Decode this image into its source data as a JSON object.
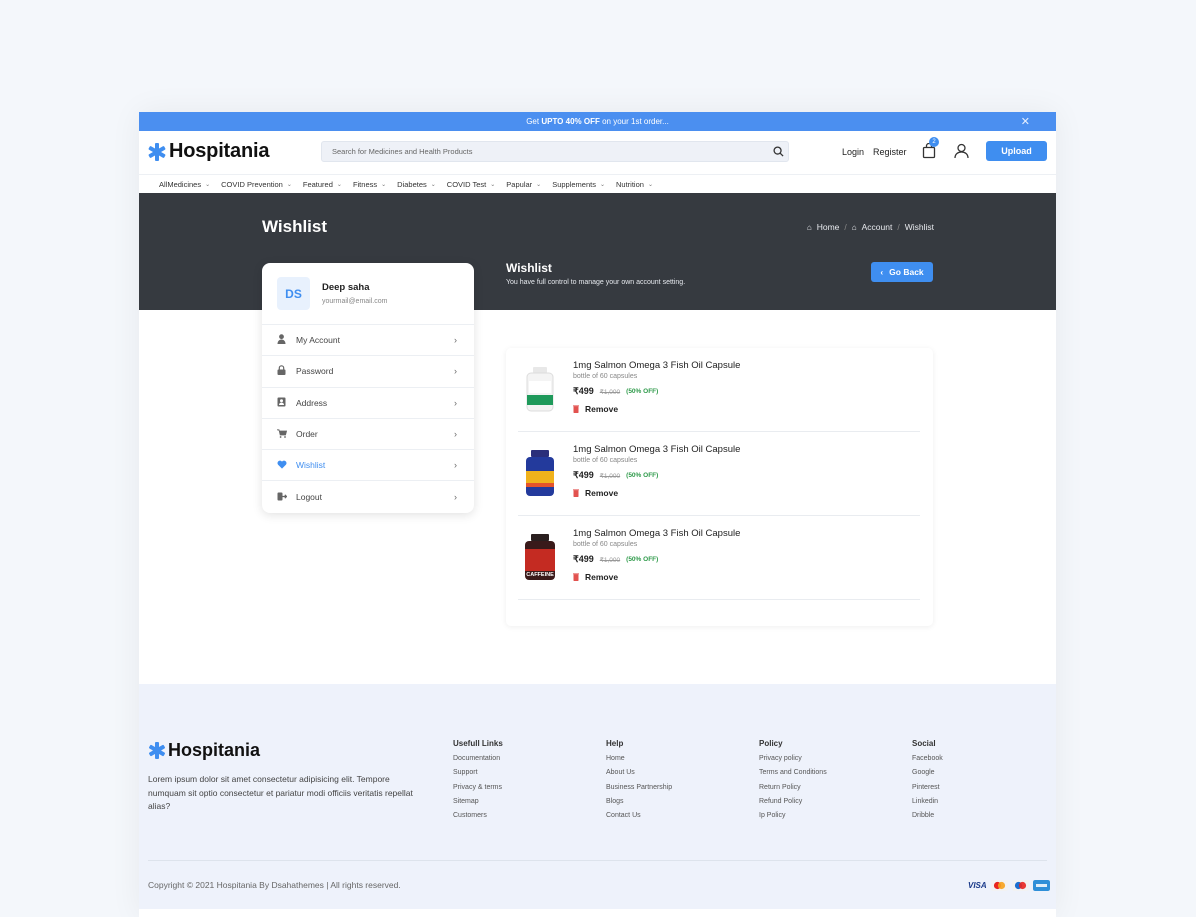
{
  "promo": {
    "prefix": "Get",
    "highlight": "UPTO 40% OFF",
    "suffix": "on your 1st order...",
    "close": "✕"
  },
  "brand": {
    "name": "Hospitania",
    "accent": "#3f8ef0"
  },
  "search": {
    "placeholder": "Search for Medicines and Health Products"
  },
  "header": {
    "login": "Login",
    "register": "Register",
    "cart_count": "2",
    "upload": "Upload"
  },
  "nav": [
    "AllMedicines",
    "COVID Prevention",
    "Featured",
    "Fitness",
    "Diabetes",
    "COVID Test",
    "Papular",
    "Supplements",
    "Nutrition"
  ],
  "hero": {
    "title": "Wishlist",
    "breadcrumb": [
      "Home",
      "Account",
      "Wishlist"
    ],
    "panel_title": "Wishlist",
    "panel_subtitle": "You have full control to manage your own account setting.",
    "go_back": "Go Back"
  },
  "profile": {
    "initials": "DS",
    "name": "Deep saha",
    "email": "yourmail@email.com"
  },
  "menu": [
    {
      "label": "My Account",
      "icon": "user-icon"
    },
    {
      "label": "Password",
      "icon": "lock-icon"
    },
    {
      "label": "Address",
      "icon": "address-book-icon"
    },
    {
      "label": "Order",
      "icon": "cart-icon"
    },
    {
      "label": "Wishlist",
      "icon": "heart-icon",
      "active": true
    },
    {
      "label": "Logout",
      "icon": "logout-icon"
    }
  ],
  "wishlist": [
    {
      "title": "1mg Salmon Omega 3 Fish Oil Capsule",
      "subtitle": "bottle of 60 capsules",
      "price": "₹499",
      "old_price": "₹1,000",
      "discount": "(50% OFF)",
      "remove": "Remove",
      "image": "white-bottle"
    },
    {
      "title": "1mg Salmon Omega 3 Fish Oil Capsule",
      "subtitle": "bottle of 60 capsules",
      "price": "₹499",
      "old_price": "₹1,000",
      "discount": "(50% OFF)",
      "remove": "Remove",
      "image": "blue-bottle"
    },
    {
      "title": "1mg Salmon Omega 3 Fish Oil Capsule",
      "subtitle": "bottle of 60 capsules",
      "price": "₹499",
      "old_price": "₹1,000",
      "discount": "(50% OFF)",
      "remove": "Remove",
      "image": "red-bottle",
      "image_label": "CAFFEINE"
    }
  ],
  "footer": {
    "brand": "Hospitania",
    "description": "Lorem ipsum dolor sit amet consectetur adipisicing elit. Tempore numquam sit optio consectetur et pariatur modi officiis veritatis repellat alias?",
    "columns": [
      {
        "heading": "Usefull Links",
        "links": [
          "Documentation",
          "Support",
          "Privacy & terms",
          "Sitemap",
          "Customers"
        ]
      },
      {
        "heading": "Help",
        "links": [
          "Home",
          "About Us",
          "Business Partnership",
          "Blogs",
          "Contact Us"
        ]
      },
      {
        "heading": "Policy",
        "links": [
          "Privacy policy",
          "Terms and Conditions",
          "Return Policy",
          "Refund Policy",
          "Ip Policy"
        ]
      },
      {
        "heading": "Social",
        "links": [
          "Facebook",
          "Google",
          "Pinterest",
          "Linkedin",
          "Dribble"
        ]
      }
    ],
    "copyright": "Copyright © 2021 Hospitania By Dsahathemes | All rights reserved.",
    "payments": [
      "VISA",
      "mastercard",
      "maestro",
      "amex"
    ]
  }
}
